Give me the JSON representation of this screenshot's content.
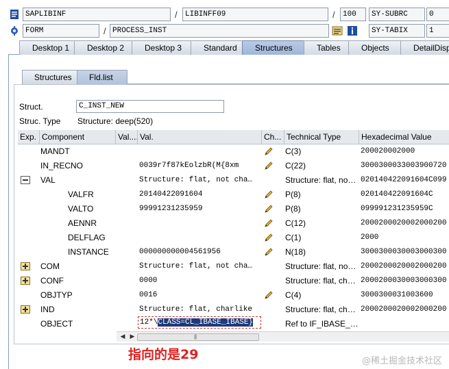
{
  "header": {
    "row1": {
      "program": "SAPLIBINF",
      "include": "LIBINFF09",
      "line": "100",
      "sysvar": "SY-SUBRC",
      "sysval": "0"
    },
    "row2": {
      "type": "FORM",
      "event": "PROCESS_INST",
      "sysvar": "SY-TABIX",
      "sysval": "1"
    }
  },
  "desktop_tabs": [
    "Desktop 1",
    "Desktop 2",
    "Desktop 3",
    "Standard",
    "Structures",
    "Tables",
    "Objects",
    "DetailDispla"
  ],
  "sub_tabs": [
    "Structures",
    "Fld.list"
  ],
  "struct": {
    "label": "Struct.",
    "value": "C_INST_NEW",
    "type_label": "Struc. Type",
    "type_value": "Structure: deep(520)"
  },
  "grid": {
    "headers": [
      "Exp.",
      "Component",
      "Val....",
      "Val.",
      "Ch...",
      "Technical Type",
      "Hexadecimal Value"
    ],
    "rows": [
      {
        "exp": "",
        "component": "MANDT",
        "val": "",
        "edit": true,
        "type": "C(3)",
        "hex": "200020002000"
      },
      {
        "exp": "",
        "component": "IN_RECNO",
        "val": "0039r7f87kEolzbR(M{8xm",
        "edit": true,
        "type": "C(22)",
        "hex": "3000300033003900720"
      },
      {
        "exp": "collapse",
        "component": "VAL",
        "val": "Structure: flat, not cha…",
        "edit": false,
        "type": "Structure: flat, no…",
        "hex": "020140422091604C099"
      },
      {
        "exp": "",
        "component": "VALFR",
        "val": "20140422091604",
        "edit": true,
        "type": "P(8)",
        "hex": "020140422091604C"
      },
      {
        "exp": "",
        "component": "VALTO",
        "val": "99991231235959",
        "edit": true,
        "type": "P(8)",
        "hex": "099991231235959C"
      },
      {
        "exp": "",
        "component": "AENNR",
        "val": "",
        "edit": true,
        "type": "C(12)",
        "hex": "2000200020002000200"
      },
      {
        "exp": "",
        "component": "DELFLAG",
        "val": "",
        "edit": true,
        "type": "C(1)",
        "hex": "2000"
      },
      {
        "exp": "",
        "component": "INSTANCE",
        "val": "000000000004561956",
        "edit": true,
        "type": "N(18)",
        "hex": "3000300030003000300"
      },
      {
        "exp": "expand",
        "component": "COM",
        "val": "Structure: flat, not cha…",
        "edit": false,
        "type": "Structure: flat, no…",
        "hex": "2000200020002000200"
      },
      {
        "exp": "expand",
        "component": "CONF",
        "val": "  0000",
        "edit": false,
        "type": "Structure: flat, ch…",
        "hex": "2000200030003000300"
      },
      {
        "exp": "",
        "component": "OBJTYP",
        "val": "0016",
        "edit": true,
        "type": "C(4)",
        "hex": "3000300031003600"
      },
      {
        "exp": "expand",
        "component": "IND",
        "val": "Structure: flat, charlike",
        "edit": false,
        "type": "Structure: flat, ch…",
        "hex": "2000200020002000200"
      },
      {
        "exp": "",
        "component": "OBJECT",
        "val": "",
        "edit": false,
        "type": "Ref to IF_IBASE_…",
        "hex": ""
      }
    ],
    "object_value_prefix": "12*\\",
    "object_value_selected": "CLASS=CL_IBASE_IBASE}"
  },
  "annotation": "指向的是29",
  "watermark": "@稀土掘金技术社区"
}
